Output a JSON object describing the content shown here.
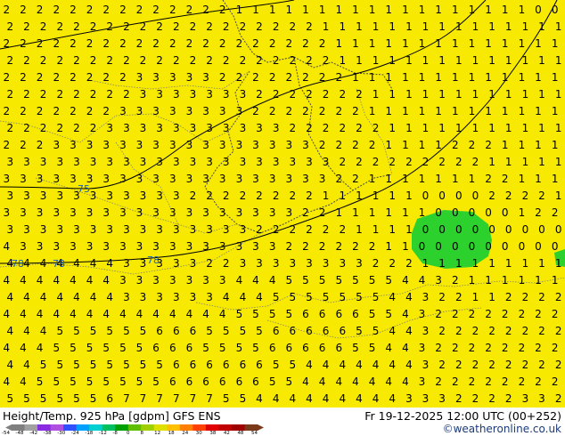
{
  "map": {
    "grid_rows": [
      "2222222222222211111111111111111100",
      "2222222222222222222111111111111111",
      "2222222222222222222211111111111111",
      "2222222222222222222211111111111111",
      "2222222233333222222221111111111111",
      "2222222233333332222222111111111111",
      "2222222333333332222222111111111111",
      "2222223333333333322222211111111111",
      "2223333333333333333222211112221111",
      "3333333333333333333322222222211111",
      "3333333333333333333322111111122111",
      "3333333333322222222111111000022221",
      "3333333333333333332211111100000122",
      "3333333333333332222221111000000000",
      "4333333333333333322222211000000000",
      "4444444333332233333333222111111111",
      "4444444333333344455555554432111111",
      "4444444333333444555555544322112222",
      "4444444444444455556666554322222222",
      "4445555556665555666665544322222222",
      "4445555556665555666665544322222222",
      "4455555555666666554444444322222222",
      "4455555555666666554444444322222222",
      "5555556777777554444444443332222332"
    ],
    "contour_labels": [
      "75",
      "78",
      "78",
      "78"
    ],
    "colors": {
      "background": "#f7ea00",
      "low_region": "#2dd12d",
      "isohypse": "#000000",
      "border": "#4a4a4a",
      "isotherm": "#777777"
    }
  },
  "footer": {
    "title": "Height/Temp. 925 hPa [gdpm] GFS ENS",
    "datetime": "Fr 19-12-2025 12:00 UTC (00+252)",
    "credit": "©weatheronline.co.uk"
  },
  "colorbar": {
    "ticks": [
      "-54",
      "-48",
      "-42",
      "-38",
      "-30",
      "-24",
      "-18",
      "-12",
      "-8",
      "0",
      "8",
      "12",
      "18",
      "24",
      "30",
      "38",
      "42",
      "48",
      "54"
    ],
    "colors": [
      "#7f7f7f",
      "#a0a0a0",
      "#8a2be2",
      "#b050e0",
      "#3050ff",
      "#00a0ff",
      "#00d0d0",
      "#00c060",
      "#00a000",
      "#60c000",
      "#a0d000",
      "#e0e000",
      "#ffc000",
      "#ff8000",
      "#ff4000",
      "#e00000",
      "#c00000",
      "#a00000",
      "#7a3a1a"
    ]
  }
}
